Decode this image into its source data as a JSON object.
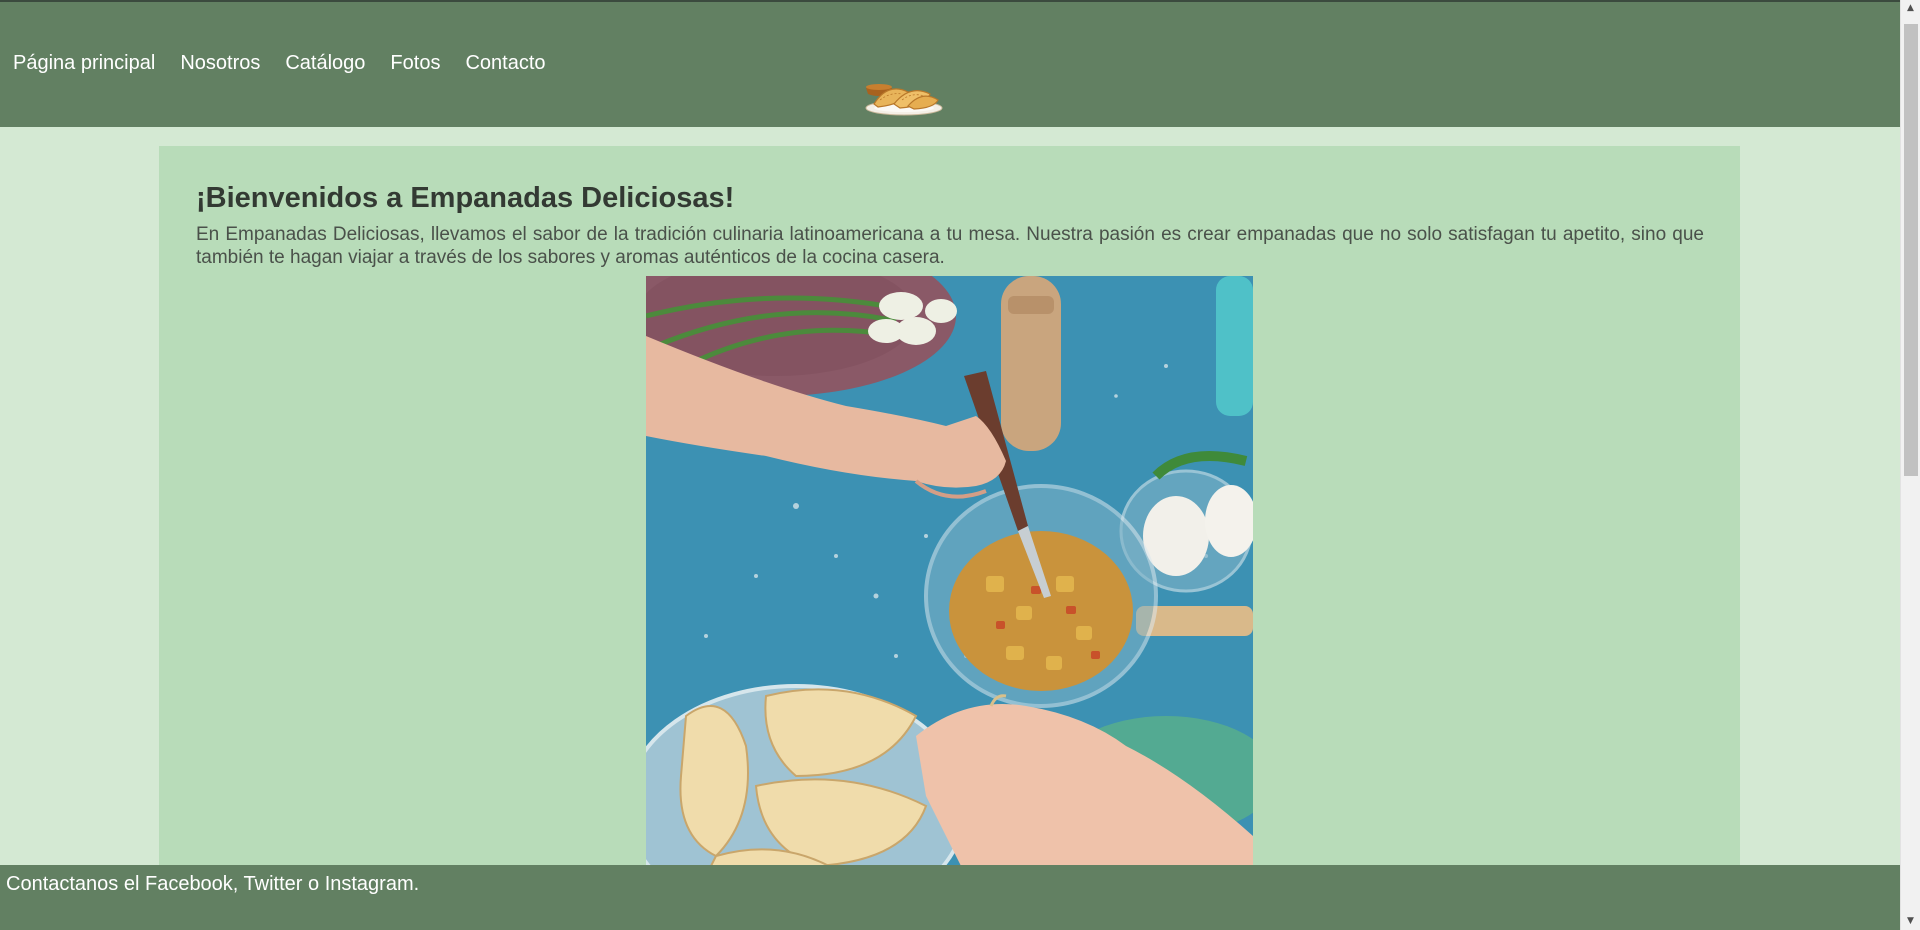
{
  "nav": {
    "items": [
      {
        "label": "Página principal"
      },
      {
        "label": "Nosotros"
      },
      {
        "label": "Catálogo"
      },
      {
        "label": "Fotos"
      },
      {
        "label": "Contacto"
      }
    ],
    "logo_icon": "empanadas-plate-icon"
  },
  "main": {
    "title": "¡Bienvenidos a Empanadas Deliciosas!",
    "intro": "En Empanadas Deliciosas, llevamos el sabor de la tradición culinaria latinoamericana a tu mesa. Nuestra pasión es crear empanadas que no solo satisfagan tu apetito, sino que también te hagan viajar a través de los sabores y aromas auténticos de la cocina casera."
  },
  "footer": {
    "text": "Contactanos el Facebook, Twitter o Instagram."
  },
  "colors": {
    "navbar": "#628062",
    "page_background": "#d4e9d3",
    "content_background": "#b8dcb9",
    "title_text": "#333a33",
    "footer": "#628062"
  }
}
